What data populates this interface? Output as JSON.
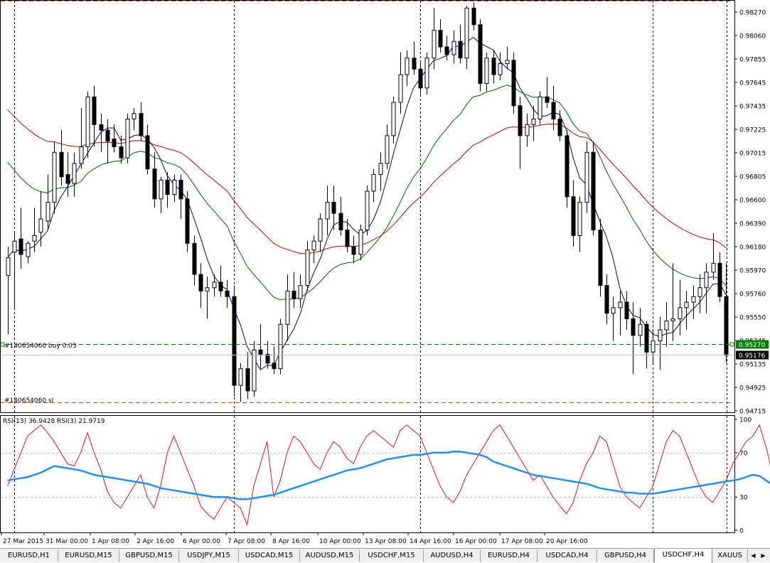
{
  "window": {
    "symbol": "USDCHF",
    "timeframe": "H4"
  },
  "orders": {
    "buy_label": "#140654060 buy 0.03",
    "buy_price": 0.9527,
    "buy_price_label": "0.95270",
    "sl_label": "#140654060 sl",
    "sl_price": 0.94749
  },
  "current_price": {
    "value": 0.95176,
    "label": "0.95176"
  },
  "price_axis": {
    "labels": [
      "0.98270",
      "0.98060",
      "0.97855",
      "0.97645",
      "0.97435",
      "0.97225",
      "0.97015",
      "0.96805",
      "0.96600",
      "0.96390",
      "0.96180",
      "0.95970",
      "0.95760",
      "0.95550",
      "0.95345",
      "0.95135",
      "0.94925",
      "0.94715"
    ]
  },
  "indicator": {
    "label": "RSI(13) 36.9428  RSI(3) 21.9719",
    "levels": [
      30,
      70
    ],
    "axis_labels": [
      "100",
      "70",
      "30",
      "0"
    ]
  },
  "time_axis": {
    "labels": [
      "27 Mar 2015",
      "31 Mar 00:00",
      "1 Apr 08:00",
      "2 Apr 16:00",
      "6 Apr 00:00",
      "7 Apr 08:00",
      "8 Apr 16:00",
      "10 Apr 00:00",
      "13 Apr 08:00",
      "14 Apr 16:00",
      "16 Apr 00:00",
      "17 Apr 08:00",
      "20 Apr 16:00"
    ]
  },
  "tabs": [
    {
      "label": "EURUSD,H1"
    },
    {
      "label": "EURUSD,M15"
    },
    {
      "label": "GBPUSD,M15"
    },
    {
      "label": "USDJPY,M15"
    },
    {
      "label": "USDCAD,M15"
    },
    {
      "label": "AUDUSD,M15"
    },
    {
      "label": "USDCHF,M15"
    },
    {
      "label": "AUDUSD,H4"
    },
    {
      "label": "EURUSD,H4"
    },
    {
      "label": "USDCAD,H4"
    },
    {
      "label": "GBPUSD,H4"
    },
    {
      "label": "USDCHF,H4",
      "active": true
    },
    {
      "label": "XAUUS"
    }
  ],
  "colors": {
    "background": "#ffffff",
    "candle": "#000000",
    "ma_fast": "#00008b",
    "ma_mid": "#006400",
    "ma_slow": "#cc0000",
    "rsi_fast": "#e0141e",
    "rsi_slow": "#1e90ff",
    "order_line": "#008000",
    "sl_line": "#b4501e",
    "current_price_box": "#000000"
  },
  "chart_data": {
    "type": "candlestick",
    "symbol": "USDCHF",
    "timeframe": "H4",
    "ylim": [
      0.9467,
      0.9836
    ],
    "candles": [
      [
        0.9589,
        0.9615,
        0.9536,
        0.9605
      ],
      [
        0.961,
        0.9627,
        0.956,
        0.962
      ],
      [
        0.9622,
        0.965,
        0.9595,
        0.9608
      ],
      [
        0.9606,
        0.962,
        0.96,
        0.9618
      ],
      [
        0.962,
        0.965,
        0.961,
        0.9625
      ],
      [
        0.9628,
        0.9665,
        0.9615,
        0.964
      ],
      [
        0.9638,
        0.968,
        0.963,
        0.9655
      ],
      [
        0.9655,
        0.971,
        0.9645,
        0.97
      ],
      [
        0.97,
        0.972,
        0.967,
        0.9678
      ],
      [
        0.968,
        0.97,
        0.966,
        0.9672
      ],
      [
        0.9672,
        0.97,
        0.966,
        0.969
      ],
      [
        0.969,
        0.974,
        0.9685,
        0.9705
      ],
      [
        0.9705,
        0.9755,
        0.9695,
        0.975
      ],
      [
        0.975,
        0.976,
        0.9705,
        0.9725
      ],
      [
        0.9725,
        0.9735,
        0.97,
        0.972
      ],
      [
        0.972,
        0.973,
        0.969,
        0.971
      ],
      [
        0.9712,
        0.9725,
        0.97,
        0.9705
      ],
      [
        0.9705,
        0.9715,
        0.969,
        0.9695
      ],
      [
        0.9695,
        0.9735,
        0.969,
        0.973
      ],
      [
        0.973,
        0.974,
        0.972,
        0.9735
      ],
      [
        0.9735,
        0.9745,
        0.971,
        0.9715
      ],
      [
        0.9715,
        0.9725,
        0.968,
        0.9685
      ],
      [
        0.9685,
        0.97,
        0.965,
        0.9658
      ],
      [
        0.9658,
        0.9678,
        0.9645,
        0.9675
      ],
      [
        0.9675,
        0.9682,
        0.965,
        0.9662
      ],
      [
        0.9662,
        0.968,
        0.9655,
        0.9675
      ],
      [
        0.9675,
        0.968,
        0.964,
        0.9658
      ],
      [
        0.9658,
        0.9665,
        0.961,
        0.9618
      ],
      [
        0.9618,
        0.9625,
        0.958,
        0.959
      ],
      [
        0.959,
        0.96,
        0.956,
        0.9575
      ],
      [
        0.9575,
        0.9588,
        0.955,
        0.9578
      ],
      [
        0.9578,
        0.959,
        0.957,
        0.9583
      ],
      [
        0.9583,
        0.9598,
        0.957,
        0.9575
      ],
      [
        0.9575,
        0.9585,
        0.956,
        0.957
      ],
      [
        0.957,
        0.958,
        0.948,
        0.949
      ],
      [
        0.949,
        0.951,
        0.9475,
        0.9505
      ],
      [
        0.9505,
        0.952,
        0.9478,
        0.9485
      ],
      [
        0.9485,
        0.953,
        0.948,
        0.9522
      ],
      [
        0.9522,
        0.9545,
        0.9505,
        0.9518
      ],
      [
        0.9518,
        0.953,
        0.9505,
        0.951
      ],
      [
        0.951,
        0.9525,
        0.95,
        0.9505
      ],
      [
        0.9505,
        0.955,
        0.95,
        0.9545
      ],
      [
        0.9545,
        0.959,
        0.953,
        0.9575
      ],
      [
        0.9575,
        0.9592,
        0.956,
        0.9568
      ],
      [
        0.9568,
        0.959,
        0.956,
        0.958
      ],
      [
        0.958,
        0.962,
        0.9575,
        0.9612
      ],
      [
        0.9612,
        0.9625,
        0.96,
        0.962
      ],
      [
        0.962,
        0.9645,
        0.961,
        0.964
      ],
      [
        0.964,
        0.967,
        0.9625,
        0.9655
      ],
      [
        0.9655,
        0.967,
        0.963,
        0.9645
      ],
      [
        0.9645,
        0.966,
        0.9625,
        0.963
      ],
      [
        0.963,
        0.964,
        0.961,
        0.9615
      ],
      [
        0.9615,
        0.9625,
        0.96,
        0.9608
      ],
      [
        0.9608,
        0.9635,
        0.9603,
        0.963
      ],
      [
        0.963,
        0.967,
        0.9625,
        0.9665
      ],
      [
        0.9665,
        0.9685,
        0.9655,
        0.968
      ],
      [
        0.968,
        0.97,
        0.9665,
        0.969
      ],
      [
        0.969,
        0.9725,
        0.9685,
        0.9715
      ],
      [
        0.9715,
        0.975,
        0.9708,
        0.9745
      ],
      [
        0.9745,
        0.979,
        0.9735,
        0.977
      ],
      [
        0.977,
        0.9792,
        0.976,
        0.9785
      ],
      [
        0.9785,
        0.98,
        0.977,
        0.9775
      ],
      [
        0.9775,
        0.9782,
        0.975,
        0.9758
      ],
      [
        0.9758,
        0.979,
        0.9752,
        0.9785
      ],
      [
        0.9785,
        0.983,
        0.9775,
        0.981
      ],
      [
        0.981,
        0.982,
        0.979,
        0.9795
      ],
      [
        0.9795,
        0.9805,
        0.9783,
        0.9788
      ],
      [
        0.9788,
        0.981,
        0.978,
        0.98
      ],
      [
        0.98,
        0.9815,
        0.978,
        0.9785
      ],
      [
        0.9785,
        0.9832,
        0.9775,
        0.983
      ],
      [
        0.983,
        0.9835,
        0.981,
        0.9815
      ],
      [
        0.9815,
        0.982,
        0.9755,
        0.9762
      ],
      [
        0.9762,
        0.979,
        0.9755,
        0.9785
      ],
      [
        0.9785,
        0.9792,
        0.9762,
        0.977
      ],
      [
        0.977,
        0.979,
        0.9765,
        0.978
      ],
      [
        0.978,
        0.9795,
        0.9775,
        0.9783
      ],
      [
        0.9783,
        0.979,
        0.9735,
        0.9742
      ],
      [
        0.9742,
        0.975,
        0.9685,
        0.9715
      ],
      [
        0.9715,
        0.9735,
        0.9705,
        0.9725
      ],
      [
        0.9725,
        0.9742,
        0.971,
        0.973
      ],
      [
        0.973,
        0.9755,
        0.9725,
        0.975
      ],
      [
        0.975,
        0.9768,
        0.974,
        0.9745
      ],
      [
        0.9745,
        0.976,
        0.972,
        0.973
      ],
      [
        0.973,
        0.9738,
        0.971,
        0.9715
      ],
      [
        0.9715,
        0.972,
        0.965,
        0.966
      ],
      [
        0.966,
        0.9675,
        0.9615,
        0.9625
      ],
      [
        0.9625,
        0.966,
        0.961,
        0.9655
      ],
      [
        0.9655,
        0.971,
        0.9645,
        0.97
      ],
      [
        0.97,
        0.971,
        0.9625,
        0.963
      ],
      [
        0.963,
        0.964,
        0.957,
        0.958
      ],
      [
        0.958,
        0.959,
        0.9545,
        0.9555
      ],
      [
        0.9555,
        0.957,
        0.953,
        0.956
      ],
      [
        0.956,
        0.9575,
        0.9535,
        0.9565
      ],
      [
        0.9565,
        0.9575,
        0.954,
        0.955
      ],
      [
        0.955,
        0.9565,
        0.95,
        0.9535
      ],
      [
        0.9535,
        0.956,
        0.9525,
        0.9545
      ],
      [
        0.9545,
        0.9548,
        0.9505,
        0.952
      ],
      [
        0.952,
        0.954,
        0.951,
        0.953
      ],
      [
        0.953,
        0.9552,
        0.9504,
        0.954
      ],
      [
        0.954,
        0.9565,
        0.9525,
        0.9548
      ],
      [
        0.9548,
        0.96,
        0.953,
        0.955
      ],
      [
        0.955,
        0.9585,
        0.9535,
        0.956
      ],
      [
        0.956,
        0.9575,
        0.954,
        0.9565
      ],
      [
        0.9565,
        0.958,
        0.955,
        0.957
      ],
      [
        0.957,
        0.959,
        0.9555,
        0.9578
      ],
      [
        0.9578,
        0.96,
        0.9555,
        0.9592
      ],
      [
        0.9592,
        0.9627,
        0.9585,
        0.96
      ],
      [
        0.96,
        0.961,
        0.9565,
        0.957
      ],
      [
        0.957,
        0.96,
        0.951,
        0.9517
      ]
    ],
    "rsi13": [
      45,
      46,
      47,
      48,
      50,
      52,
      55,
      58,
      57,
      56,
      55,
      54,
      52,
      50,
      49,
      48,
      47,
      46,
      45,
      44,
      43,
      42,
      40,
      38,
      37,
      36,
      35,
      34,
      33,
      32,
      31,
      30,
      30,
      30,
      29,
      28,
      28,
      29,
      30,
      31,
      32,
      34,
      36,
      38,
      40,
      42,
      44,
      46,
      48,
      50,
      52,
      54,
      55,
      56,
      58,
      60,
      62,
      64,
      65,
      66,
      67,
      68,
      68,
      69,
      70,
      70,
      70,
      71,
      71,
      70,
      69,
      68,
      66,
      62,
      60,
      58,
      56,
      54,
      52,
      50,
      49,
      48,
      47,
      46,
      45,
      44,
      43,
      42,
      40,
      38,
      37,
      36,
      35,
      34,
      34,
      33,
      33,
      33,
      34,
      35,
      36,
      37,
      38,
      39,
      40,
      41,
      42,
      43,
      44,
      45,
      46,
      48,
      50,
      49,
      45,
      41,
      37
    ],
    "rsi3": [
      40,
      55,
      70,
      85,
      90,
      95,
      88,
      80,
      70,
      60,
      58,
      70,
      88,
      70,
      55,
      35,
      25,
      20,
      30,
      40,
      50,
      30,
      20,
      40,
      70,
      85,
      70,
      55,
      40,
      22,
      15,
      10,
      20,
      30,
      25,
      20,
      5,
      40,
      60,
      80,
      30,
      45,
      70,
      85,
      80,
      70,
      60,
      55,
      70,
      80,
      75,
      65,
      60,
      75,
      85,
      90,
      85,
      80,
      75,
      90,
      95,
      90,
      85,
      70,
      55,
      40,
      30,
      25,
      35,
      50,
      60,
      70,
      80,
      90,
      95,
      85,
      75,
      65,
      55,
      45,
      50,
      40,
      30,
      22,
      15,
      25,
      45,
      60,
      70,
      85,
      80,
      60,
      40,
      30,
      25,
      20,
      30,
      40,
      60,
      80,
      90,
      85,
      70,
      55,
      40,
      30,
      25,
      35,
      45,
      60,
      70,
      80,
      85,
      95,
      75,
      50,
      22
    ]
  }
}
